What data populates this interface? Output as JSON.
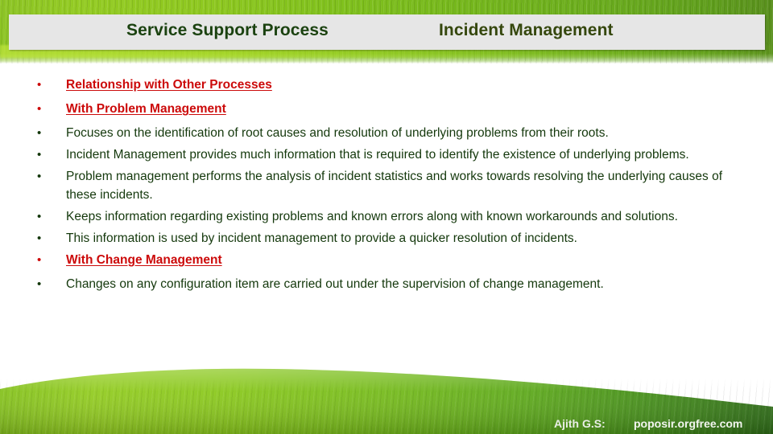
{
  "header": {
    "title_primary": "Service Support Process",
    "title_secondary": "Incident Management"
  },
  "colors": {
    "accent_red": "#cc0a0a",
    "body_green": "#14380c",
    "title_green": "#1b4210",
    "header_bg": "#e6e6e6",
    "grass_green": "#8cc424"
  },
  "bullets": [
    {
      "text": "Relationship with Other Processes",
      "style": "accent"
    },
    {
      "text": "With Problem Management",
      "style": "accent"
    },
    {
      "text": "Focuses on the identification of root causes and resolution of underlying problems from their roots.",
      "style": "body"
    },
    {
      "text": "Incident Management provides much information that is required to identify the existence of underlying problems.",
      "style": "body"
    },
    {
      "text": "Problem management performs the analysis of incident statistics and works towards resolving the underlying causes of these incidents.",
      "style": "body"
    },
    {
      "text": "Keeps information regarding existing problems and known errors along with known workarounds and solutions.",
      "style": "body"
    },
    {
      "text": "This information is used by incident management to provide a quicker resolution of incidents.",
      "style": "body"
    },
    {
      "text": "With Change Management",
      "style": "accent"
    },
    {
      "text": "Changes on any configuration item are carried out under the supervision of change management.",
      "style": "body"
    }
  ],
  "bullet_marker": "•",
  "footer": {
    "author": "Ajith G.S:",
    "site": "poposir.orgfree.com"
  }
}
